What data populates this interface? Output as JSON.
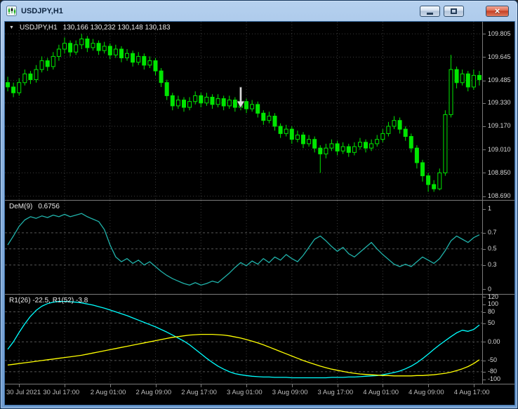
{
  "window": {
    "title": "USDJPY,H1",
    "controls": {
      "close": "×"
    }
  },
  "panes": {
    "price": {
      "collapse_icon": "▼",
      "symbol": "USDJPY,H1",
      "ohlc": "130,166 130,232 130,148 130,183"
    },
    "dem": {
      "label": "DeM(9)",
      "value": "0.6756"
    },
    "osc": {
      "label": "R1(26) -22.5, R1(52) -3.8"
    }
  },
  "chart_data": [
    {
      "type": "candlestick",
      "title": "USDJPY,H1",
      "ylim": [
        108.664,
        109.888
      ],
      "yticks": [
        {
          "v": 109.805,
          "label": "109.805"
        },
        {
          "v": 109.645,
          "label": "109.645"
        },
        {
          "v": 109.485,
          "label": "109.485"
        },
        {
          "v": 109.33,
          "label": "109.330"
        },
        {
          "v": 109.17,
          "label": "109.170"
        },
        {
          "v": 109.01,
          "label": "109.010"
        },
        {
          "v": 108.85,
          "label": "108.850"
        },
        {
          "v": 108.69,
          "label": "108.690"
        }
      ],
      "xticks": [
        {
          "bar": 2,
          "label": "30 Jul 2021"
        },
        {
          "bar": 10,
          "label": "30 Jul 17:00"
        },
        {
          "bar": 18,
          "label": "2 Aug 01:00"
        },
        {
          "bar": 26,
          "label": "2 Aug 09:00"
        },
        {
          "bar": 34,
          "label": "2 Aug 17:00"
        },
        {
          "bar": 42,
          "label": "3 Aug 01:00"
        },
        {
          "bar": 50,
          "label": "3 Aug 09:00"
        },
        {
          "bar": 58,
          "label": "3 Aug 17:00"
        },
        {
          "bar": 66,
          "label": "4 Aug 01:00"
        },
        {
          "bar": 74,
          "label": "4 Aug 09:00"
        },
        {
          "bar": 82,
          "label": "4 Aug 17:00"
        }
      ],
      "colors": {
        "up_body": "#000000",
        "down_body": "#00e600",
        "outline": "#00e600",
        "grid": "#3c3c3c"
      },
      "annotation": {
        "type": "down-arrow",
        "bar": 41,
        "price": 109.295,
        "color": "#d9d9d9"
      },
      "ohlc": [
        [
          109.47,
          109.51,
          109.41,
          109.44
        ],
        [
          109.44,
          109.47,
          109.37,
          109.4
        ],
        [
          109.4,
          109.5,
          109.38,
          109.47
        ],
        [
          109.47,
          109.56,
          109.45,
          109.53
        ],
        [
          109.53,
          109.55,
          109.46,
          109.49
        ],
        [
          109.49,
          109.59,
          109.47,
          109.56
        ],
        [
          109.56,
          109.65,
          109.54,
          109.62
        ],
        [
          109.62,
          109.64,
          109.55,
          109.58
        ],
        [
          109.58,
          109.68,
          109.56,
          109.65
        ],
        [
          109.65,
          109.73,
          109.62,
          109.7
        ],
        [
          109.7,
          109.78,
          109.67,
          109.74
        ],
        [
          109.74,
          109.76,
          109.65,
          109.68
        ],
        [
          109.68,
          109.76,
          109.66,
          109.73
        ],
        [
          109.73,
          109.805,
          109.7,
          109.77
        ],
        [
          109.77,
          109.79,
          109.68,
          109.71
        ],
        [
          109.71,
          109.77,
          109.69,
          109.74
        ],
        [
          109.74,
          109.76,
          109.66,
          109.69
        ],
        [
          109.69,
          109.75,
          109.67,
          109.72
        ],
        [
          109.72,
          109.74,
          109.63,
          109.66
        ],
        [
          109.66,
          109.73,
          109.64,
          109.7
        ],
        [
          109.7,
          109.72,
          109.61,
          109.64
        ],
        [
          109.64,
          109.7,
          109.62,
          109.67
        ],
        [
          109.67,
          109.69,
          109.58,
          109.61
        ],
        [
          109.61,
          109.68,
          109.59,
          109.65
        ],
        [
          109.65,
          109.67,
          109.56,
          109.59
        ],
        [
          109.59,
          109.65,
          109.57,
          109.62
        ],
        [
          109.62,
          109.64,
          109.52,
          109.55
        ],
        [
          109.55,
          109.57,
          109.44,
          109.47
        ],
        [
          109.47,
          109.49,
          109.35,
          109.38
        ],
        [
          109.38,
          109.4,
          109.28,
          109.31
        ],
        [
          109.31,
          109.38,
          109.29,
          109.35
        ],
        [
          109.35,
          109.37,
          109.27,
          109.3
        ],
        [
          109.3,
          109.37,
          109.28,
          109.34
        ],
        [
          109.34,
          109.41,
          109.32,
          109.38
        ],
        [
          109.38,
          109.4,
          109.3,
          109.33
        ],
        [
          109.33,
          109.4,
          109.31,
          109.37
        ],
        [
          109.37,
          109.39,
          109.29,
          109.32
        ],
        [
          109.32,
          109.39,
          109.3,
          109.36
        ],
        [
          109.36,
          109.38,
          109.28,
          109.31
        ],
        [
          109.31,
          109.38,
          109.29,
          109.35
        ],
        [
          109.35,
          109.37,
          109.27,
          109.3
        ],
        [
          109.3,
          109.37,
          109.28,
          109.34
        ],
        [
          109.34,
          109.36,
          109.26,
          109.29
        ],
        [
          109.29,
          109.35,
          109.27,
          109.32
        ],
        [
          109.32,
          109.34,
          109.23,
          109.26
        ],
        [
          109.26,
          109.28,
          109.18,
          109.21
        ],
        [
          109.21,
          109.27,
          109.19,
          109.24
        ],
        [
          109.24,
          109.26,
          109.14,
          109.17
        ],
        [
          109.17,
          109.19,
          109.09,
          109.12
        ],
        [
          109.12,
          109.18,
          109.1,
          109.15
        ],
        [
          109.15,
          109.17,
          109.05,
          109.08
        ],
        [
          109.08,
          109.14,
          109.06,
          109.11
        ],
        [
          109.11,
          109.13,
          109.02,
          109.05
        ],
        [
          109.05,
          109.11,
          109.03,
          109.08
        ],
        [
          109.08,
          109.1,
          108.99,
          109.02
        ],
        [
          109.02,
          109.04,
          108.85,
          108.98
        ],
        [
          108.98,
          109.05,
          108.95,
          109.02
        ],
        [
          109.02,
          109.08,
          109.0,
          109.05
        ],
        [
          109.05,
          109.07,
          108.97,
          109.0
        ],
        [
          109.0,
          109.06,
          108.98,
          109.03
        ],
        [
          109.03,
          109.05,
          108.96,
          108.99
        ],
        [
          108.99,
          109.06,
          108.97,
          109.03
        ],
        [
          109.03,
          109.09,
          109.01,
          109.06
        ],
        [
          109.06,
          109.08,
          108.99,
          109.02
        ],
        [
          109.02,
          109.08,
          109.0,
          109.05
        ],
        [
          109.05,
          109.11,
          109.03,
          109.08
        ],
        [
          109.08,
          109.15,
          109.06,
          109.12
        ],
        [
          109.12,
          109.2,
          109.1,
          109.17
        ],
        [
          109.17,
          109.24,
          109.15,
          109.21
        ],
        [
          109.21,
          109.23,
          109.12,
          109.15
        ],
        [
          109.15,
          109.17,
          109.07,
          109.1
        ],
        [
          109.1,
          109.12,
          108.99,
          109.02
        ],
        [
          109.02,
          109.04,
          108.88,
          108.92
        ],
        [
          108.92,
          108.94,
          108.79,
          108.83
        ],
        [
          108.83,
          108.85,
          108.72,
          108.77
        ],
        [
          108.77,
          108.8,
          108.72,
          108.74
        ],
        [
          108.74,
          108.88,
          108.73,
          108.85
        ],
        [
          108.85,
          109.28,
          108.83,
          109.25
        ],
        [
          109.25,
          109.66,
          109.23,
          109.56
        ],
        [
          109.56,
          109.58,
          109.43,
          109.47
        ],
        [
          109.47,
          109.56,
          109.45,
          109.53
        ],
        [
          109.53,
          109.55,
          109.41,
          109.44
        ],
        [
          109.44,
          109.56,
          109.42,
          109.52
        ],
        [
          109.52,
          109.55,
          109.45,
          109.49
        ]
      ]
    },
    {
      "type": "line",
      "name": "DeM(9)",
      "current_value": 0.6756,
      "color": "#20b2aa",
      "ylim": [
        -0.06,
        1.1
      ],
      "yticks": [
        {
          "v": 1,
          "label": "1"
        },
        {
          "v": 0.7,
          "label": "0.7"
        },
        {
          "v": 0.5,
          "label": "0.5"
        },
        {
          "v": 0.3,
          "label": "0.3"
        },
        {
          "v": 0,
          "label": "0"
        }
      ],
      "levels": [
        0.7,
        0.5,
        0.3
      ],
      "values": [
        0.55,
        0.66,
        0.78,
        0.86,
        0.9,
        0.88,
        0.91,
        0.89,
        0.92,
        0.9,
        0.93,
        0.9,
        0.92,
        0.94,
        0.9,
        0.87,
        0.84,
        0.74,
        0.55,
        0.4,
        0.34,
        0.38,
        0.32,
        0.36,
        0.3,
        0.34,
        0.28,
        0.22,
        0.17,
        0.13,
        0.1,
        0.07,
        0.05,
        0.08,
        0.05,
        0.07,
        0.1,
        0.08,
        0.14,
        0.2,
        0.27,
        0.33,
        0.29,
        0.35,
        0.31,
        0.38,
        0.33,
        0.4,
        0.36,
        0.43,
        0.38,
        0.34,
        0.42,
        0.52,
        0.62,
        0.66,
        0.6,
        0.53,
        0.47,
        0.52,
        0.44,
        0.4,
        0.46,
        0.52,
        0.58,
        0.5,
        0.43,
        0.37,
        0.31,
        0.28,
        0.31,
        0.28,
        0.34,
        0.4,
        0.36,
        0.32,
        0.38,
        0.48,
        0.6,
        0.66,
        0.62,
        0.58,
        0.64,
        0.6756
      ]
    },
    {
      "type": "line",
      "name": "R1 oscillator",
      "label": "R1(26) -22.5, R1(52) -3.8",
      "ylim": [
        -112,
        126
      ],
      "yticks": [
        {
          "v": 120,
          "label": "120"
        },
        {
          "v": 100,
          "label": "100"
        },
        {
          "v": 80,
          "label": "80"
        },
        {
          "v": 50,
          "label": "50"
        },
        {
          "v": 0,
          "label": "0.00"
        },
        {
          "v": -50,
          "label": "-50"
        },
        {
          "v": -80,
          "label": "-80"
        },
        {
          "v": -100,
          "label": "-100"
        }
      ],
      "levels": [
        80,
        50,
        0,
        -50,
        -80
      ],
      "series": [
        {
          "name": "R1(26)",
          "color": "#00ffff",
          "values": [
            -20,
            0,
            25,
            48,
            68,
            84,
            95,
            102,
            106,
            108,
            108,
            107,
            106,
            104,
            101,
            98,
            94,
            90,
            85,
            80,
            75,
            70,
            64,
            58,
            52,
            46,
            40,
            33,
            26,
            18,
            10,
            2,
            -8,
            -20,
            -32,
            -44,
            -55,
            -65,
            -73,
            -80,
            -85,
            -88,
            -90,
            -92,
            -93,
            -94,
            -94,
            -95,
            -95,
            -95,
            -96,
            -96,
            -96,
            -96,
            -96,
            -96,
            -96,
            -95,
            -95,
            -95,
            -94,
            -94,
            -93,
            -92,
            -91,
            -90,
            -88,
            -85,
            -82,
            -78,
            -72,
            -65,
            -56,
            -45,
            -33,
            -20,
            -8,
            3,
            14,
            24,
            31,
            28,
            33,
            45
          ]
        },
        {
          "name": "R1(52)",
          "color": "#ffff00",
          "values": [
            -62,
            -60,
            -58,
            -56,
            -54,
            -52,
            -50,
            -48,
            -46,
            -44,
            -42,
            -40,
            -38,
            -36,
            -33,
            -30,
            -27,
            -24,
            -21,
            -18,
            -15,
            -12,
            -9,
            -6,
            -3,
            0,
            3,
            6,
            9,
            12,
            14,
            16,
            18,
            19,
            20,
            20,
            20,
            19,
            18,
            16,
            13,
            10,
            6,
            2,
            -3,
            -8,
            -14,
            -20,
            -26,
            -32,
            -38,
            -44,
            -50,
            -55,
            -60,
            -65,
            -69,
            -73,
            -76,
            -79,
            -82,
            -84,
            -86,
            -87,
            -88,
            -89,
            -90,
            -90,
            -91,
            -91,
            -91,
            -91,
            -90,
            -90,
            -89,
            -88,
            -86,
            -84,
            -81,
            -77,
            -72,
            -66,
            -58,
            -48
          ]
        }
      ]
    }
  ]
}
